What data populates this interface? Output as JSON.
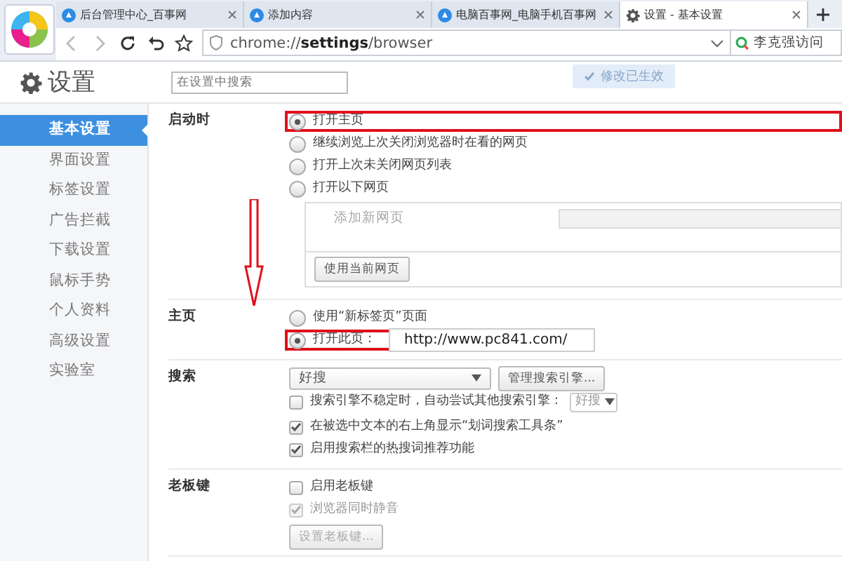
{
  "tabs": [
    {
      "title": "后台管理中心_百事网",
      "kind": "site",
      "selected": false
    },
    {
      "title": "添加内容",
      "kind": "site",
      "selected": false
    },
    {
      "title": "电脑百事网_电脑手机百事网",
      "kind": "site",
      "selected": false
    },
    {
      "title": "设置 - 基本设置",
      "kind": "settings",
      "selected": true
    }
  ],
  "toolbar": {
    "address": "chrome://**settings**/browser",
    "search_hint": "李克强访问"
  },
  "header": {
    "title": "设置",
    "search": {
      "placeholder": "在设置中搜索"
    },
    "toast": "修改已生效"
  },
  "sidebar": {
    "items": [
      {
        "label": "基本设置",
        "selected": true
      },
      {
        "label": "界面设置",
        "selected": false
      },
      {
        "label": "标签设置",
        "selected": false
      },
      {
        "label": "广告拦截",
        "selected": false
      },
      {
        "label": "下载设置",
        "selected": false
      },
      {
        "label": "鼠标手势",
        "selected": false
      },
      {
        "label": "个人资料",
        "selected": false
      },
      {
        "label": "高级设置",
        "selected": false
      },
      {
        "label": "实验室",
        "selected": false
      }
    ]
  },
  "sections": [
    {
      "label": "启动时",
      "rows": [
        {
          "kind": "radio",
          "label": "打开主页",
          "selected": true,
          "highlighted": true
        },
        {
          "kind": "radio",
          "label": "继续浏览上次关闭浏览器时在看的网页",
          "selected": false,
          "highlighted": false
        },
        {
          "kind": "radio",
          "label": "打开上次未关闭网页列表",
          "selected": false,
          "highlighted": false
        },
        {
          "kind": "radio",
          "label": "打开以下网页",
          "selected": false,
          "highlighted": false
        },
        {
          "kind": "pages",
          "placeholder": "添加新网页",
          "button": "使用当前网页"
        }
      ]
    },
    {
      "label": "主页",
      "rows": [
        {
          "kind": "radio",
          "label": "使用“新标签页”页面",
          "selected": false,
          "highlighted": false
        },
        {
          "kind": "radio-url",
          "label": "打开此页：",
          "value": "http://www.pc841.com/",
          "selected": true,
          "highlighted": true
        }
      ]
    },
    {
      "label": "搜索",
      "rows": [
        {
          "kind": "select",
          "value": "好搜",
          "button": "管理搜索引擎..."
        },
        {
          "kind": "checkbox",
          "label": "搜索引擎不稳定时，自动尝试其他搜索引擎：",
          "checked": false,
          "disabled": false,
          "select": "好搜"
        },
        {
          "kind": "checkbox",
          "label": "在被选中文本的右上角显示“划词搜索工具条”",
          "checked": true,
          "disabled": false
        },
        {
          "kind": "checkbox",
          "label": "启用搜索栏的热搜词推荐功能",
          "checked": true,
          "disabled": false
        }
      ]
    },
    {
      "label": "老板键",
      "rows": [
        {
          "kind": "checkbox",
          "label": "启用老板键",
          "checked": false,
          "disabled": false
        },
        {
          "kind": "checkbox",
          "label": "浏览器同时静音",
          "checked": true,
          "disabled": true
        },
        {
          "kind": "button",
          "label": "设置老板键...",
          "disabled": true
        }
      ]
    }
  ]
}
